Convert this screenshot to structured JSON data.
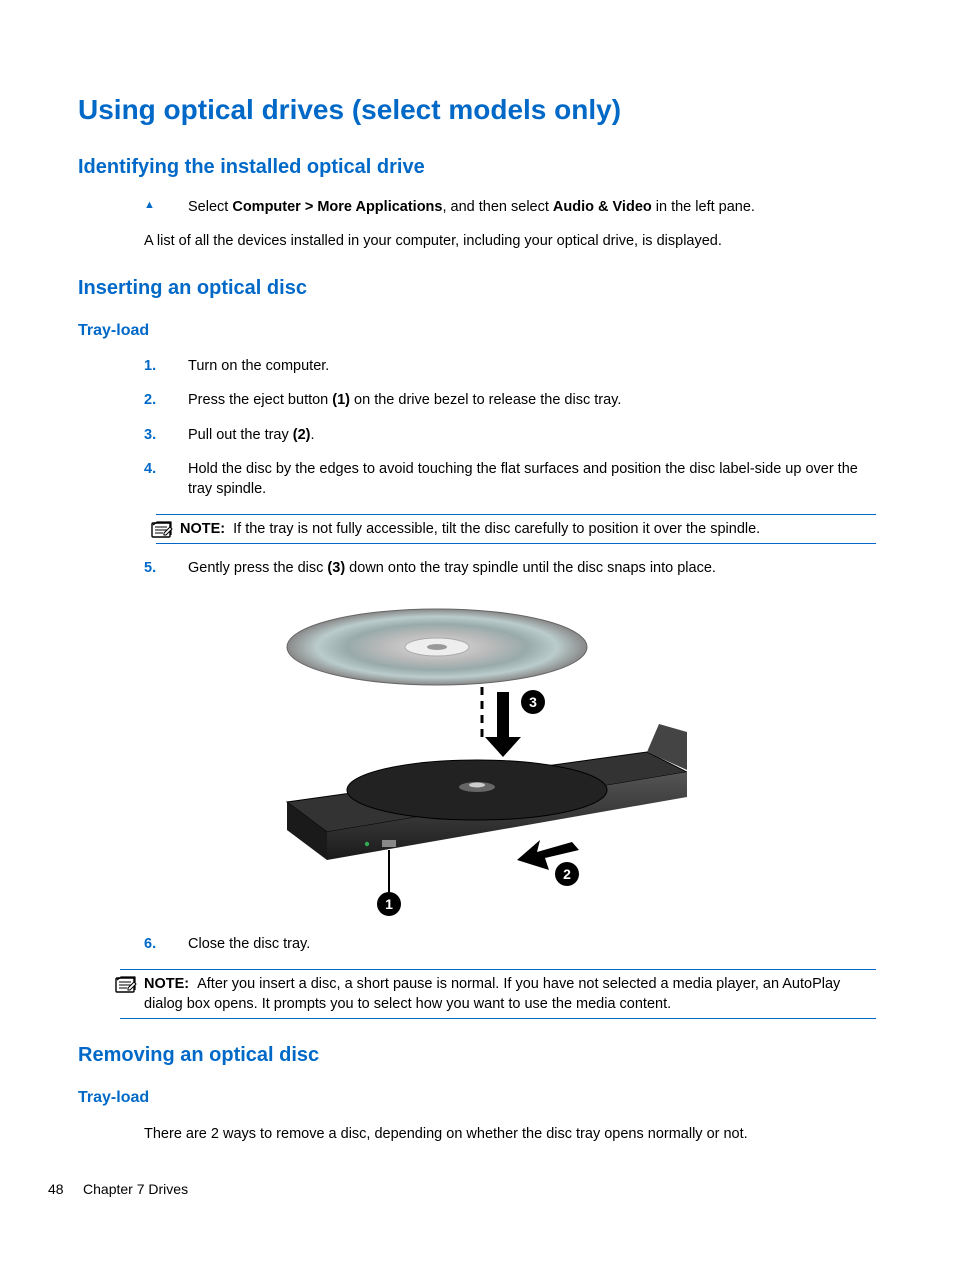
{
  "title": "Using optical drives (select models only)",
  "section1": {
    "heading": "Identifying the installed optical drive",
    "bullet_marker": "▲",
    "instruction_pre": "Select ",
    "instruction_bold1": "Computer > More Applications",
    "instruction_mid": ", and then select ",
    "instruction_bold2": "Audio & Video",
    "instruction_post": " in the left pane.",
    "para": "A list of all the devices installed in your computer, including your optical drive, is displayed."
  },
  "section2": {
    "heading": "Inserting an optical disc",
    "subheading": "Tray-load",
    "steps": [
      {
        "n": "1.",
        "text_pre": "Turn on the computer.",
        "bold": "",
        "text_post": ""
      },
      {
        "n": "2.",
        "text_pre": "Press the eject button ",
        "bold": "(1)",
        "text_post": " on the drive bezel to release the disc tray."
      },
      {
        "n": "3.",
        "text_pre": "Pull out the tray ",
        "bold": "(2)",
        "text_post": "."
      },
      {
        "n": "4.",
        "text_pre": "Hold the disc by the edges to avoid touching the flat surfaces and position the disc label-side up over the tray spindle.",
        "bold": "",
        "text_post": ""
      }
    ],
    "note1_label": "NOTE:",
    "note1_text": "If the tray is not fully accessible, tilt the disc carefully to position it over the spindle.",
    "step5_n": "5.",
    "step5_pre": "Gently press the disc ",
    "step5_bold": "(3)",
    "step5_post": " down onto the tray spindle until the disc snaps into place.",
    "step6_n": "6.",
    "step6_text": "Close the disc tray.",
    "note2_label": "NOTE:",
    "note2_text": "After you insert a disc, a short pause is normal. If you have not selected a media player, an AutoPlay dialog box opens. It prompts you to select how you want to use the media content."
  },
  "section3": {
    "heading": "Removing an optical disc",
    "subheading": "Tray-load",
    "para": "There are 2 ways to remove a disc, depending on whether the disc tray opens normally or not."
  },
  "footer": {
    "page_num": "48",
    "chapter": "Chapter 7   Drives"
  },
  "icons": {
    "note": "note-icon"
  },
  "illustration": {
    "callouts": [
      "1",
      "2",
      "3"
    ]
  }
}
